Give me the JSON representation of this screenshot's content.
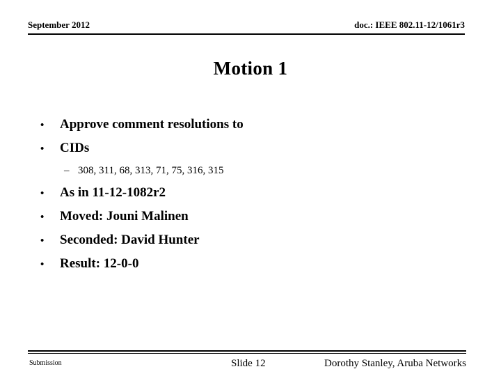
{
  "header": {
    "date": "September 2012",
    "doc": "doc.: IEEE 802.11-12/1061r3"
  },
  "title": "Motion 1",
  "body": {
    "bullet_marker": "•",
    "sub_bullet_marker": "–",
    "items": [
      {
        "level": 1,
        "text": "Approve comment resolutions to"
      },
      {
        "level": 1,
        "text": "CIDs"
      },
      {
        "level": 2,
        "text": "308, 311, 68, 313, 71, 75, 316, 315"
      },
      {
        "level": 1,
        "text": "As in 11-12-1082r2"
      },
      {
        "level": 1,
        "text": "Moved: Jouni Malinen"
      },
      {
        "level": 1,
        "text": "Seconded: David Hunter"
      },
      {
        "level": 1,
        "text": "Result: 12-0-0"
      }
    ]
  },
  "footer": {
    "submission": "Submission",
    "slide": "Slide 12",
    "author": "Dorothy Stanley, Aruba Networks"
  },
  "colors": {
    "text": "#000000",
    "background": "#ffffff",
    "rule": "#000000"
  }
}
